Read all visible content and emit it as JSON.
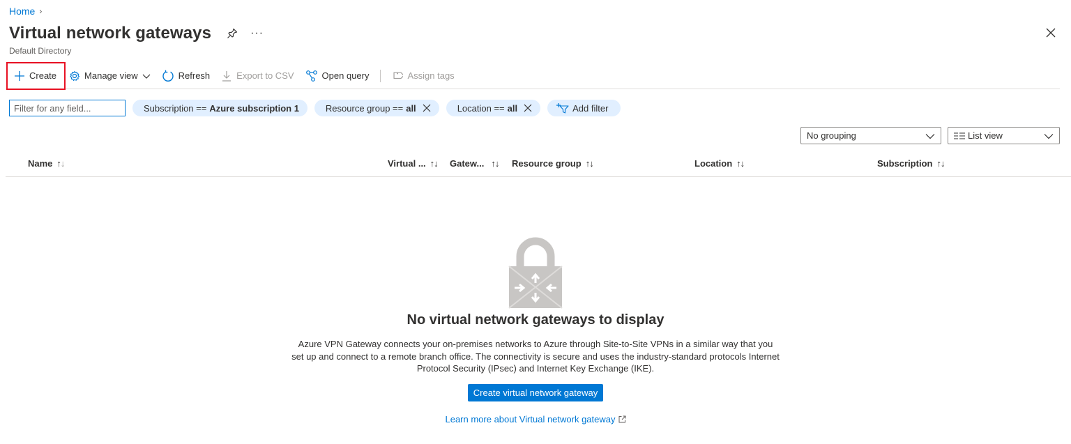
{
  "breadcrumb": {
    "home": "Home",
    "separator": "›"
  },
  "header": {
    "title": "Virtual network gateways",
    "subtitle": "Default Directory",
    "more_label": "···"
  },
  "toolbar": {
    "create": "Create",
    "manage_view": "Manage view",
    "refresh": "Refresh",
    "export_csv": "Export to CSV",
    "open_query": "Open query",
    "assign_tags": "Assign tags"
  },
  "filters": {
    "search_placeholder": "Filter for any field...",
    "subscription": {
      "label": "Subscription ==",
      "value": "Azure subscription 1"
    },
    "resource_group": {
      "label": "Resource group ==",
      "value": "all"
    },
    "location": {
      "label": "Location ==",
      "value": "all"
    },
    "add_filter": "Add filter"
  },
  "view_controls": {
    "grouping": "No grouping",
    "view": "List view"
  },
  "table": {
    "columns": [
      "Name",
      "Virtual ...",
      "Gatew...",
      "Resource group",
      "Location",
      "Subscription"
    ]
  },
  "empty_state": {
    "title": "No virtual network gateways to display",
    "description": "Azure VPN Gateway connects your on-premises networks to Azure through Site-to-Site VPNs in a similar way that you set up and connect to a remote branch office. The connectivity is secure and uses the industry-standard protocols Internet Protocol Security (IPsec) and Internet Key Exchange (IKE).",
    "button": "Create virtual network gateway",
    "learn_more": "Learn more about Virtual network gateway"
  },
  "colors": {
    "accent": "#0078d4",
    "highlight": "#e81123",
    "pill_bg": "#e1efff"
  }
}
